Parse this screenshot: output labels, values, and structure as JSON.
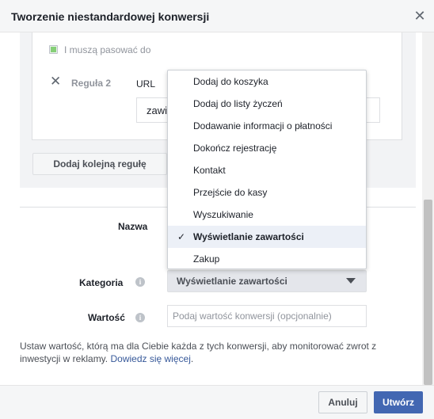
{
  "dialog": {
    "title": "Tworzenie niestandardowej konwersji",
    "close_icon": "close-icon"
  },
  "rules": {
    "match_label": "I muszą pasować do",
    "rule2_label": "Reguła 2",
    "rule2_field": "URL",
    "rule2_input_value": "zawie",
    "add_rule_label": "Dodaj kolejną regułę"
  },
  "form": {
    "name_label": "Nazwa",
    "category_label": "Kategoria",
    "category_value": "Wyświetlanie zawartości",
    "value_label": "Wartość",
    "value_placeholder": "Podaj wartość konwersji (opcjonalnie)",
    "info_icon": "i",
    "help_text": "Ustaw wartość, którą ma dla Ciebie każda z tych konwersji, aby monitorować zwrot z inwestycji w reklamy.",
    "help_link": "Dowiedz się więcej",
    "help_end": "."
  },
  "category_menu": {
    "items": [
      {
        "label": "Dodaj do koszyka",
        "selected": false
      },
      {
        "label": "Dodaj do listy życzeń",
        "selected": false
      },
      {
        "label": "Dodawanie informacji o płatności",
        "selected": false
      },
      {
        "label": "Dokończ rejestrację",
        "selected": false
      },
      {
        "label": "Kontakt",
        "selected": false
      },
      {
        "label": "Przejście do kasy",
        "selected": false
      },
      {
        "label": "Wyszukiwanie",
        "selected": false
      },
      {
        "label": "Wyświetlanie zawartości",
        "selected": true
      },
      {
        "label": "Zakup",
        "selected": false
      }
    ],
    "check_mark": "✓"
  },
  "footer": {
    "cancel_label": "Anuluj",
    "create_label": "Utwórz"
  },
  "colors": {
    "primary": "#4267b2",
    "link": "#365899",
    "selected_row": "#ecf0f7"
  }
}
